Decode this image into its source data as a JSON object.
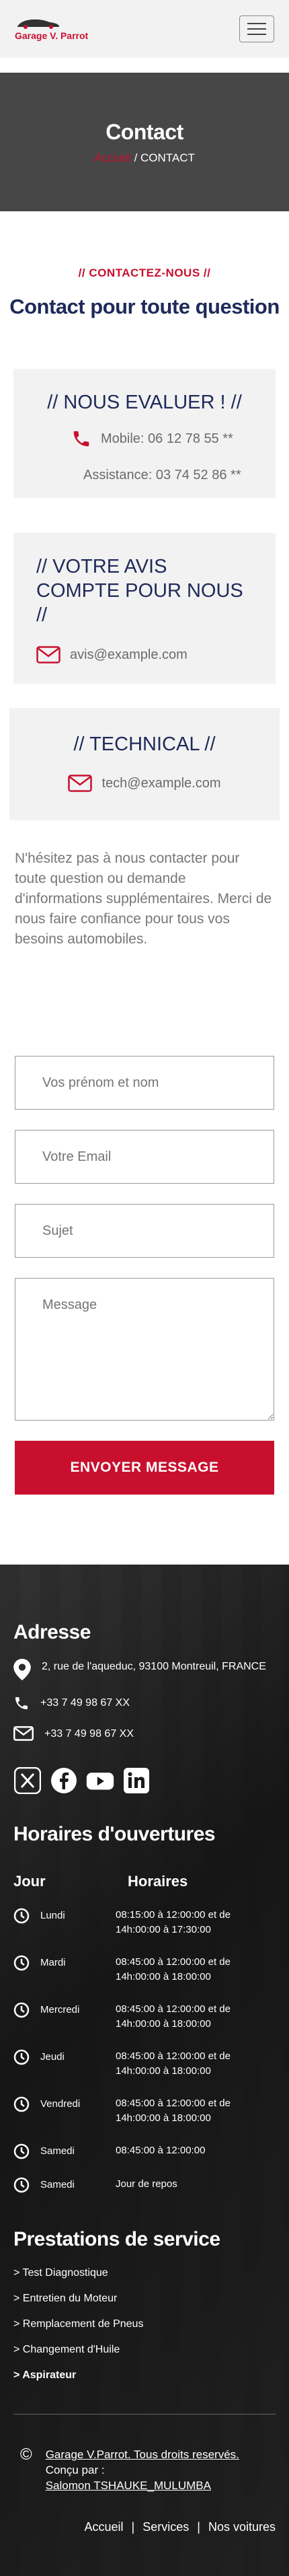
{
  "header": {
    "logo_text": "Garage V. Parrot",
    "menu_icon": "hamburger-icon"
  },
  "banner": {
    "title": "Contact",
    "breadcrumb_home": "Accueil",
    "breadcrumb_sep": " / ",
    "breadcrumb_current": "CONTACT"
  },
  "contact": {
    "kicker": "// CONTACTEZ-NOUS //",
    "title": "Contact pour toute question"
  },
  "cards": {
    "evaluate": {
      "title": "// NOUS EVALUER ! //",
      "mobile": "Mobile: 06 12 78 55 **",
      "assistance": "Assistance: 03 74 52 86 **",
      "icon": "phone-icon"
    },
    "avis": {
      "title": "// VOTRE AVIS COMPTE POUR NOUS //",
      "email": "avis@example.com",
      "icon": "envelope-icon"
    },
    "technical": {
      "title": "// TECHNICAL //",
      "email": "tech@example.com",
      "icon": "envelope-icon"
    }
  },
  "intro": "N'hésitez pas à nous contacter pour toute question ou demande d'informations supplémentaires. Merci de nous faire confiance pour tous vos besoins automobiles.",
  "form": {
    "name_placeholder": "Vos prénom et nom",
    "email_placeholder": "Votre Email",
    "subject_placeholder": "Sujet",
    "message_placeholder": "Message",
    "submit_label": "ENVOYER MESSAGE"
  },
  "footer": {
    "address_title": "Adresse",
    "address": "2, rue de l'aqueduc, 93100 Montreuil, FRANCE",
    "phone": "+33 7 49 98 67 XX",
    "email": "+33 7 49 98 67 XX",
    "socials": [
      "x-icon",
      "facebook-icon",
      "youtube-icon",
      "linkedin-icon"
    ],
    "hours_title": "Horaires d'ouvertures",
    "hours_col_day": "Jour",
    "hours_col_time": "Horaires",
    "hours": [
      {
        "day": "Lundi",
        "time": "08:15:00 à 12:00:00 et de 14h:00:00 à 17:30:00"
      },
      {
        "day": "Mardi",
        "time": "08:45:00 à 12:00:00 et de 14h:00:00 à 18:00:00"
      },
      {
        "day": "Mercredi",
        "time": "08:45:00 à 12:00:00 et de 14h:00:00 à 18:00:00"
      },
      {
        "day": "Jeudi",
        "time": "08:45:00 à 12:00:00 et de 14h:00:00 à 18:00:00"
      },
      {
        "day": "Vendredi",
        "time": "08:45:00 à 12:00:00 et de 14h:00:00 à 18:00:00"
      },
      {
        "day": "Samedi",
        "time": "08:45:00 à 12:00:00"
      },
      {
        "day": "Samedi",
        "time": "Jour de repos"
      }
    ],
    "services_title": "Prestations de service",
    "services": [
      {
        "label": "> Test Diagnostique",
        "active": false
      },
      {
        "label": "> Entretien du Moteur",
        "active": false
      },
      {
        "label": "> Remplacement de Pneus",
        "active": false
      },
      {
        "label": "> Changement d'Huile",
        "active": false
      },
      {
        "label": "> Aspirateur",
        "active": true
      }
    ],
    "copyright_symbol": "©",
    "copyright_text": "Garage V.Parrot. Tous droits reservés.",
    "designed_by": "Conçu par :",
    "designer": "Salomon TSHAUKE_MULUMBA",
    "links": [
      "Accueil",
      "Services",
      "Nos voitures"
    ],
    "link_sep": "|"
  },
  "colors": {
    "accent": "#c8102e",
    "navy": "#1e2a5a",
    "banner_bg": "#474747",
    "card_bg": "#f2f2f2",
    "footer_bg": "#1a1a1a"
  }
}
